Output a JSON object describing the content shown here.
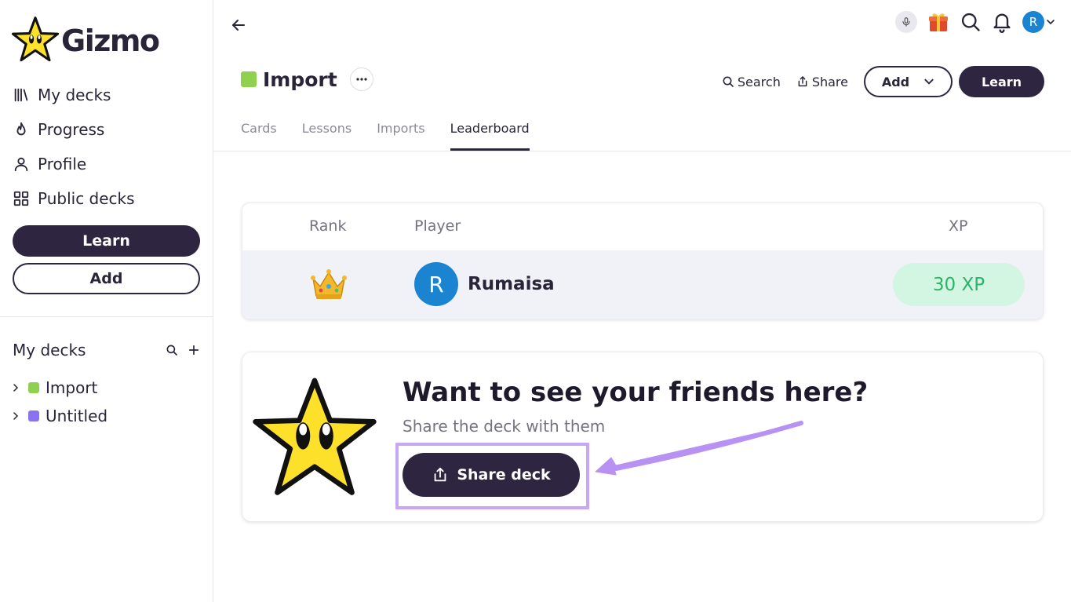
{
  "app": {
    "name": "Gizmo"
  },
  "sidebar": {
    "nav": [
      {
        "label": "My decks",
        "icon": "library-icon"
      },
      {
        "label": "Progress",
        "icon": "flame-icon"
      },
      {
        "label": "Profile",
        "icon": "user-icon"
      },
      {
        "label": "Public decks",
        "icon": "grid-icon"
      }
    ],
    "learn_label": "Learn",
    "add_label": "Add",
    "my_decks_title": "My decks",
    "decks": [
      {
        "label": "Import",
        "color": "#8fd14f"
      },
      {
        "label": "Untitled",
        "color": "#8a72f0"
      }
    ]
  },
  "topbar": {
    "avatar_initial": "R"
  },
  "deck": {
    "title": "Import",
    "color": "#8fd14f",
    "search_label": "Search",
    "share_label": "Share",
    "add_label": "Add",
    "learn_label": "Learn",
    "tabs": [
      {
        "label": "Cards",
        "active": false
      },
      {
        "label": "Lessons",
        "active": false
      },
      {
        "label": "Imports",
        "active": false
      },
      {
        "label": "Leaderboard",
        "active": true
      }
    ]
  },
  "leaderboard": {
    "headers": {
      "rank": "Rank",
      "player": "Player",
      "xp": "XP"
    },
    "rows": [
      {
        "rank_icon": "crown-icon",
        "avatar_initial": "R",
        "name": "Rumaisa",
        "xp": "30 XP"
      }
    ]
  },
  "invite": {
    "title": "Want to see your friends here?",
    "subtitle": "Share the deck with them",
    "button_label": "Share deck"
  },
  "colors": {
    "primary_dark": "#2e2640",
    "avatar_blue": "#1a84d0",
    "xp_bg": "#d2f6e2",
    "xp_text": "#2cb36a",
    "highlight": "#c7a6f5",
    "star_yellow": "#fde02a"
  }
}
